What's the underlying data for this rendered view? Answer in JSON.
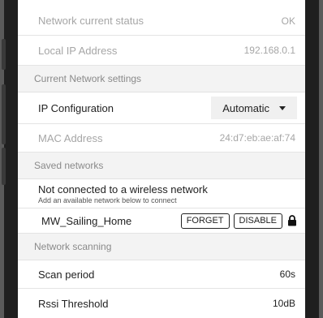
{
  "status_rows": [
    {
      "label": "Network current status",
      "value": "OK"
    },
    {
      "label": "Local IP Address",
      "value": "192.168.0.1"
    }
  ],
  "sections": {
    "current_network": "Current Network settings",
    "saved": "Saved networks",
    "scanning": "Network scanning"
  },
  "ip_config": {
    "label": "IP Configuration",
    "selected": "Automatic"
  },
  "mac": {
    "label": "MAC Address",
    "value": "24:d7:eb:ae:af:74"
  },
  "not_connected": {
    "title": "Not connected to a wireless network",
    "subtitle": "Add an available network below to connect"
  },
  "saved_network": {
    "name": "MW_Sailing_Home",
    "forget": "FORGET",
    "disable": "DISABLE",
    "icon": "lock-icon"
  },
  "scan": [
    {
      "label": "Scan period",
      "value": "60s"
    },
    {
      "label": "Rssi Threshold",
      "value": "10dB"
    }
  ]
}
